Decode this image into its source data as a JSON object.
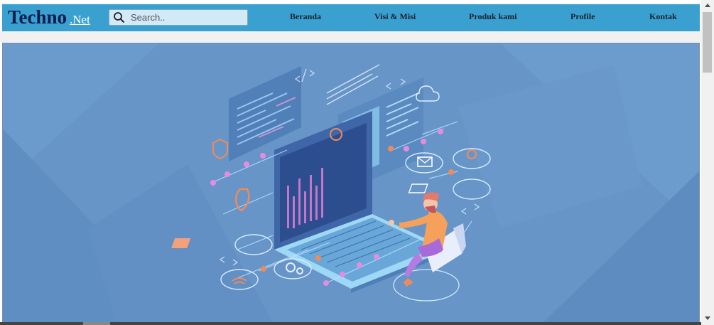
{
  "brand": {
    "main": "Techno",
    "sub": ".Net"
  },
  "search": {
    "placeholder": "Search.."
  },
  "nav": {
    "items": [
      {
        "label": "Beranda"
      },
      {
        "label": "Visi & Misi"
      },
      {
        "label": "Produk kami"
      },
      {
        "label": "Profile"
      },
      {
        "label": "Kontak"
      }
    ]
  },
  "colors": {
    "navbar": "#3aa0cf",
    "brand": "#0b1b4e",
    "hero_bg": "#6795c8"
  },
  "icons": {
    "search": "search-icon",
    "hero": "laptop-developer-illustration"
  }
}
